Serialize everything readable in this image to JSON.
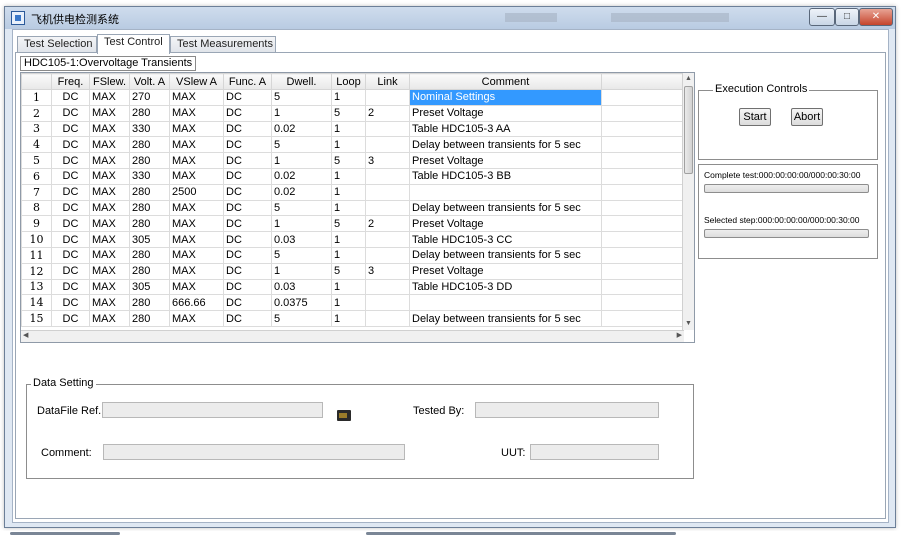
{
  "window": {
    "title": "飞机供电检测系统"
  },
  "tabs": [
    {
      "label": "Test Selection",
      "active": false
    },
    {
      "label": "Test Control",
      "active": true
    },
    {
      "label": "Test Measurements",
      "active": false
    }
  ],
  "test_caption": "HDC105-1:Overvoltage Transients",
  "table": {
    "columns": [
      "",
      "Freq.",
      "FSlew.",
      "Volt. A",
      "VSlew A",
      "Func. A",
      "Dwell.",
      "Loop",
      "Link",
      "Comment",
      ""
    ],
    "selected_row": 0,
    "rows": [
      [
        "1",
        "DC",
        "MAX",
        "270",
        "MAX",
        "DC",
        "5",
        "1",
        "",
        "Nominal Settings",
        ""
      ],
      [
        "2",
        "DC",
        "MAX",
        "280",
        "MAX",
        "DC",
        "1",
        "5",
        "2",
        "Preset Voltage",
        ""
      ],
      [
        "3",
        "DC",
        "MAX",
        "330",
        "MAX",
        "DC",
        "0.02",
        "1",
        "",
        "Table HDC105-3 AA",
        ""
      ],
      [
        "4",
        "DC",
        "MAX",
        "280",
        "MAX",
        "DC",
        "5",
        "1",
        "",
        "Delay between transients for 5 sec",
        ""
      ],
      [
        "5",
        "DC",
        "MAX",
        "280",
        "MAX",
        "DC",
        "1",
        "5",
        "3",
        "Preset Voltage",
        ""
      ],
      [
        "6",
        "DC",
        "MAX",
        "330",
        "MAX",
        "DC",
        "0.02",
        "1",
        "",
        "Table HDC105-3 BB",
        ""
      ],
      [
        "7",
        "DC",
        "MAX",
        "280",
        "2500",
        "DC",
        "0.02",
        "1",
        "",
        "",
        ""
      ],
      [
        "8",
        "DC",
        "MAX",
        "280",
        "MAX",
        "DC",
        "5",
        "1",
        "",
        "Delay between transients for 5 sec",
        ""
      ],
      [
        "9",
        "DC",
        "MAX",
        "280",
        "MAX",
        "DC",
        "1",
        "5",
        "2",
        "Preset Voltage",
        ""
      ],
      [
        "10",
        "DC",
        "MAX",
        "305",
        "MAX",
        "DC",
        "0.03",
        "1",
        "",
        "Table HDC105-3 CC",
        ""
      ],
      [
        "11",
        "DC",
        "MAX",
        "280",
        "MAX",
        "DC",
        "5",
        "1",
        "",
        "Delay between transients for 5 sec",
        ""
      ],
      [
        "12",
        "DC",
        "MAX",
        "280",
        "MAX",
        "DC",
        "1",
        "5",
        "3",
        "Preset Voltage",
        ""
      ],
      [
        "13",
        "DC",
        "MAX",
        "305",
        "MAX",
        "DC",
        "0.03",
        "1",
        "",
        "Table HDC105-3 DD",
        ""
      ],
      [
        "14",
        "DC",
        "MAX",
        "280",
        "666.66",
        "DC",
        "0.0375",
        "1",
        "",
        "",
        ""
      ],
      [
        "15",
        "DC",
        "MAX",
        "280",
        "MAX",
        "DC",
        "5",
        "1",
        "",
        "Delay between transients for 5 sec",
        ""
      ]
    ]
  },
  "execution": {
    "title": "Execution Controls",
    "start_label": "Start",
    "abort_label": "Abort"
  },
  "status": {
    "complete_label": "Complete test:000:00:00:00/000:00:30:00",
    "complete_progress": 0,
    "selected_label": "Selected step:000:00:00:00/000:00:30:00",
    "selected_progress": 0
  },
  "data_setting": {
    "title": "Data Setting",
    "datafile_label": "DataFile Ref.:",
    "datafile_value": "",
    "tested_by_label": "Tested By:",
    "tested_by_value": "",
    "comment_label": "Comment:",
    "comment_value": "",
    "uut_label": "UUT:",
    "uut_value": ""
  },
  "colors": {
    "selection": "#3399ff",
    "window_frame": "#dfe8f3"
  }
}
